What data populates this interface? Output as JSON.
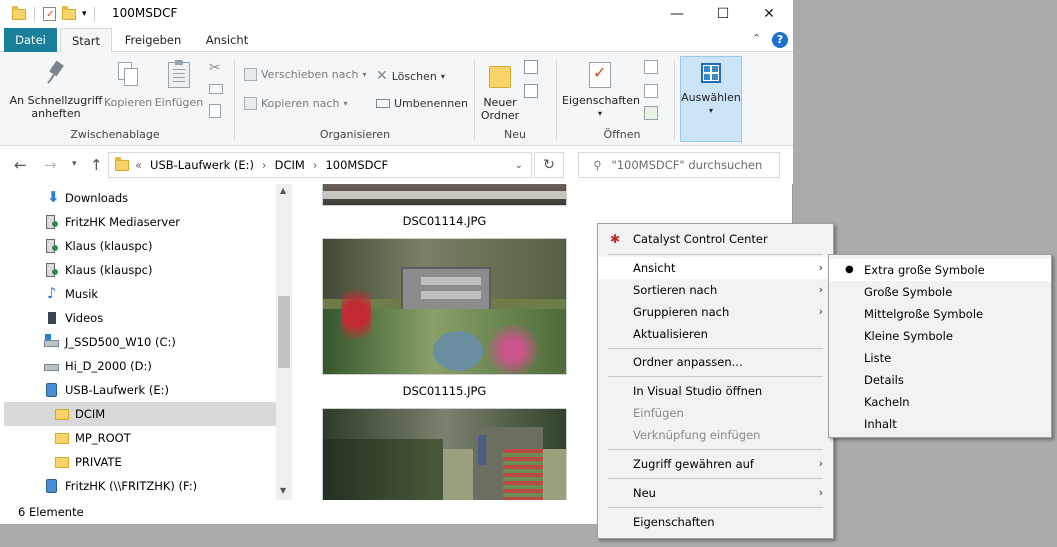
{
  "window": {
    "title": "100MSDCF",
    "controls": {
      "minimize": "—",
      "maximize": "☐",
      "close": "✕"
    }
  },
  "tabs": [
    {
      "label": "Datei"
    },
    {
      "label": "Start"
    },
    {
      "label": "Freigeben"
    },
    {
      "label": "Ansicht"
    }
  ],
  "ribbon": {
    "zwischenablage": {
      "label": "Zwischenablage",
      "pin": "An Schnellzugriff anheften",
      "copy": "Kopieren",
      "paste": "Einfügen"
    },
    "organisieren": {
      "label": "Organisieren",
      "move": "Verschieben nach",
      "copyto": "Kopieren nach",
      "delete": "Löschen",
      "rename": "Umbenennen"
    },
    "neu": {
      "label": "Neu",
      "newfolder": "Neuer Ordner"
    },
    "oeffnen": {
      "label": "Öffnen",
      "props": "Eigenschaften"
    },
    "auswaehlen": {
      "label": "Auswählen"
    }
  },
  "address": {
    "crumbs": [
      "USB-Laufwerk (E:)",
      "DCIM",
      "100MSDCF"
    ],
    "search_placeholder": "\"100MSDCF\" durchsuchen"
  },
  "nav": [
    {
      "label": "Downloads",
      "icon": "download-icon"
    },
    {
      "label": "FritzHK Mediaserver",
      "icon": "media-server-icon"
    },
    {
      "label": "Klaus (klauspc)",
      "icon": "media-server-icon"
    },
    {
      "label": "Klaus (klauspc)",
      "icon": "media-server-icon"
    },
    {
      "label": "Musik",
      "icon": "music-icon"
    },
    {
      "label": "Videos",
      "icon": "video-icon"
    },
    {
      "label": "J_SSD500_W10 (C:)",
      "icon": "drive-icon"
    },
    {
      "label": "Hi_D_2000 (D:)",
      "icon": "drive-icon"
    },
    {
      "label": "USB-Laufwerk (E:)",
      "icon": "usb-drive-icon"
    },
    {
      "label": "DCIM",
      "icon": "folder-icon",
      "selected": true
    },
    {
      "label": "MP_ROOT",
      "icon": "folder-icon"
    },
    {
      "label": "PRIVATE",
      "icon": "folder-icon"
    },
    {
      "label": "FritzHK (\\\\FRITZHK) (F:)",
      "icon": "network-drive-icon"
    }
  ],
  "files": [
    {
      "name": "DSC01114.JPG"
    },
    {
      "name": "DSC01115.JPG"
    },
    {
      "name": ""
    }
  ],
  "status": {
    "count": "6 Elemente"
  },
  "context_menu": {
    "items": [
      {
        "label": "Catalyst Control Center",
        "icon": "catalyst-icon"
      },
      {
        "label": "Ansicht",
        "submenu": true
      },
      {
        "label": "Sortieren nach",
        "submenu": true
      },
      {
        "label": "Gruppieren nach",
        "submenu": true
      },
      {
        "label": "Aktualisieren"
      },
      {
        "label": "Ordner anpassen..."
      },
      {
        "label": "In Visual Studio öffnen"
      },
      {
        "label": "Einfügen",
        "disabled": true
      },
      {
        "label": "Verknüpfung einfügen",
        "disabled": true
      },
      {
        "label": "Zugriff gewähren auf",
        "submenu": true
      },
      {
        "label": "Neu",
        "submenu": true
      },
      {
        "label": "Eigenschaften"
      }
    ]
  },
  "view_submenu": {
    "items": [
      {
        "label": "Extra große Symbole",
        "checked": true
      },
      {
        "label": "Große Symbole"
      },
      {
        "label": "Mittelgroße Symbole"
      },
      {
        "label": "Kleine Symbole"
      },
      {
        "label": "Liste"
      },
      {
        "label": "Details"
      },
      {
        "label": "Kacheln"
      },
      {
        "label": "Inhalt"
      }
    ]
  },
  "colors": {
    "datei_tab": "#1a7f9b",
    "selection": "#d9d9d9",
    "help": "#1e6fd0"
  }
}
